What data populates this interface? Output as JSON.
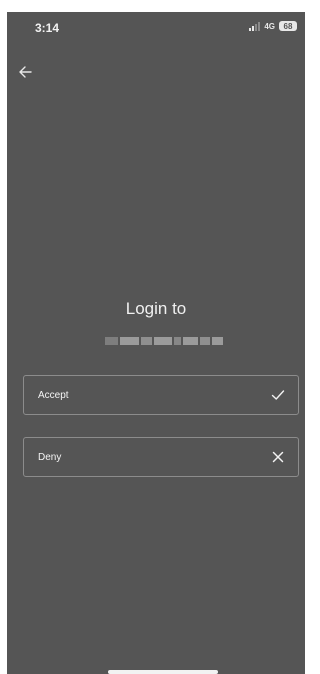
{
  "status_bar": {
    "time": "3:14",
    "network": "4G",
    "battery": "68",
    "icons": [
      "signal-icon",
      "battery-icon"
    ]
  },
  "header": {
    "back_icon": "arrow-left-icon"
  },
  "main": {
    "title": "Login to"
  },
  "options": {
    "accept": {
      "label": "Accept",
      "icon": "checkmark-icon"
    },
    "deny": {
      "label": "Deny",
      "icon": "close-icon"
    }
  },
  "colors": {
    "background": "#555555",
    "text": "#ffffff",
    "border": "#8c8c8c"
  }
}
